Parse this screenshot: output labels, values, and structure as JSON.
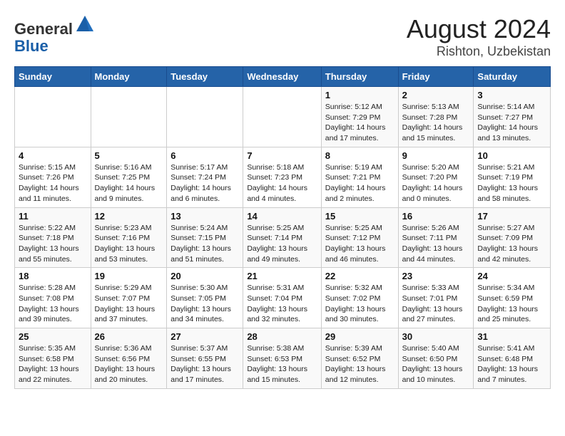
{
  "header": {
    "logo_line1": "General",
    "logo_line2": "Blue",
    "month_year": "August 2024",
    "location": "Rishton, Uzbekistan"
  },
  "weekdays": [
    "Sunday",
    "Monday",
    "Tuesday",
    "Wednesday",
    "Thursday",
    "Friday",
    "Saturday"
  ],
  "weeks": [
    [
      {
        "day": "",
        "info": ""
      },
      {
        "day": "",
        "info": ""
      },
      {
        "day": "",
        "info": ""
      },
      {
        "day": "",
        "info": ""
      },
      {
        "day": "1",
        "info": "Sunrise: 5:12 AM\nSunset: 7:29 PM\nDaylight: 14 hours\nand 17 minutes."
      },
      {
        "day": "2",
        "info": "Sunrise: 5:13 AM\nSunset: 7:28 PM\nDaylight: 14 hours\nand 15 minutes."
      },
      {
        "day": "3",
        "info": "Sunrise: 5:14 AM\nSunset: 7:27 PM\nDaylight: 14 hours\nand 13 minutes."
      }
    ],
    [
      {
        "day": "4",
        "info": "Sunrise: 5:15 AM\nSunset: 7:26 PM\nDaylight: 14 hours\nand 11 minutes."
      },
      {
        "day": "5",
        "info": "Sunrise: 5:16 AM\nSunset: 7:25 PM\nDaylight: 14 hours\nand 9 minutes."
      },
      {
        "day": "6",
        "info": "Sunrise: 5:17 AM\nSunset: 7:24 PM\nDaylight: 14 hours\nand 6 minutes."
      },
      {
        "day": "7",
        "info": "Sunrise: 5:18 AM\nSunset: 7:23 PM\nDaylight: 14 hours\nand 4 minutes."
      },
      {
        "day": "8",
        "info": "Sunrise: 5:19 AM\nSunset: 7:21 PM\nDaylight: 14 hours\nand 2 minutes."
      },
      {
        "day": "9",
        "info": "Sunrise: 5:20 AM\nSunset: 7:20 PM\nDaylight: 14 hours\nand 0 minutes."
      },
      {
        "day": "10",
        "info": "Sunrise: 5:21 AM\nSunset: 7:19 PM\nDaylight: 13 hours\nand 58 minutes."
      }
    ],
    [
      {
        "day": "11",
        "info": "Sunrise: 5:22 AM\nSunset: 7:18 PM\nDaylight: 13 hours\nand 55 minutes."
      },
      {
        "day": "12",
        "info": "Sunrise: 5:23 AM\nSunset: 7:16 PM\nDaylight: 13 hours\nand 53 minutes."
      },
      {
        "day": "13",
        "info": "Sunrise: 5:24 AM\nSunset: 7:15 PM\nDaylight: 13 hours\nand 51 minutes."
      },
      {
        "day": "14",
        "info": "Sunrise: 5:25 AM\nSunset: 7:14 PM\nDaylight: 13 hours\nand 49 minutes."
      },
      {
        "day": "15",
        "info": "Sunrise: 5:25 AM\nSunset: 7:12 PM\nDaylight: 13 hours\nand 46 minutes."
      },
      {
        "day": "16",
        "info": "Sunrise: 5:26 AM\nSunset: 7:11 PM\nDaylight: 13 hours\nand 44 minutes."
      },
      {
        "day": "17",
        "info": "Sunrise: 5:27 AM\nSunset: 7:09 PM\nDaylight: 13 hours\nand 42 minutes."
      }
    ],
    [
      {
        "day": "18",
        "info": "Sunrise: 5:28 AM\nSunset: 7:08 PM\nDaylight: 13 hours\nand 39 minutes."
      },
      {
        "day": "19",
        "info": "Sunrise: 5:29 AM\nSunset: 7:07 PM\nDaylight: 13 hours\nand 37 minutes."
      },
      {
        "day": "20",
        "info": "Sunrise: 5:30 AM\nSunset: 7:05 PM\nDaylight: 13 hours\nand 34 minutes."
      },
      {
        "day": "21",
        "info": "Sunrise: 5:31 AM\nSunset: 7:04 PM\nDaylight: 13 hours\nand 32 minutes."
      },
      {
        "day": "22",
        "info": "Sunrise: 5:32 AM\nSunset: 7:02 PM\nDaylight: 13 hours\nand 30 minutes."
      },
      {
        "day": "23",
        "info": "Sunrise: 5:33 AM\nSunset: 7:01 PM\nDaylight: 13 hours\nand 27 minutes."
      },
      {
        "day": "24",
        "info": "Sunrise: 5:34 AM\nSunset: 6:59 PM\nDaylight: 13 hours\nand 25 minutes."
      }
    ],
    [
      {
        "day": "25",
        "info": "Sunrise: 5:35 AM\nSunset: 6:58 PM\nDaylight: 13 hours\nand 22 minutes."
      },
      {
        "day": "26",
        "info": "Sunrise: 5:36 AM\nSunset: 6:56 PM\nDaylight: 13 hours\nand 20 minutes."
      },
      {
        "day": "27",
        "info": "Sunrise: 5:37 AM\nSunset: 6:55 PM\nDaylight: 13 hours\nand 17 minutes."
      },
      {
        "day": "28",
        "info": "Sunrise: 5:38 AM\nSunset: 6:53 PM\nDaylight: 13 hours\nand 15 minutes."
      },
      {
        "day": "29",
        "info": "Sunrise: 5:39 AM\nSunset: 6:52 PM\nDaylight: 13 hours\nand 12 minutes."
      },
      {
        "day": "30",
        "info": "Sunrise: 5:40 AM\nSunset: 6:50 PM\nDaylight: 13 hours\nand 10 minutes."
      },
      {
        "day": "31",
        "info": "Sunrise: 5:41 AM\nSunset: 6:48 PM\nDaylight: 13 hours\nand 7 minutes."
      }
    ]
  ]
}
